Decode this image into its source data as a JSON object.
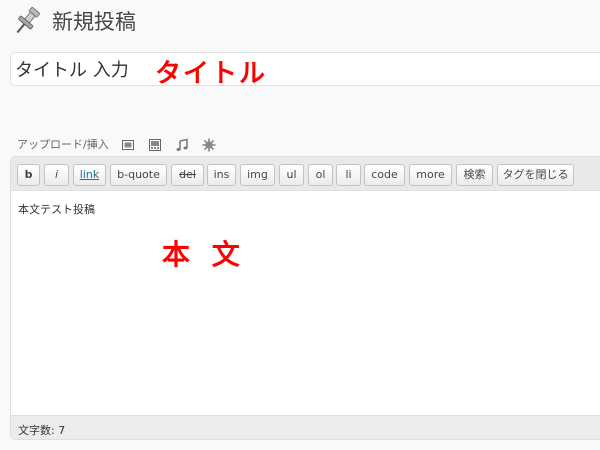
{
  "header": {
    "title": "新規投稿",
    "icon": "pushpin-icon"
  },
  "title_field": {
    "value": "タイトル 入力",
    "annotation": "タイトル"
  },
  "media": {
    "label": "アップロード/挿入",
    "icons": [
      "image-icon",
      "gallery-icon",
      "audio-icon",
      "media-icon"
    ]
  },
  "toolbar": {
    "buttons": [
      {
        "label": "b"
      },
      {
        "label": "i"
      },
      {
        "label": "link"
      },
      {
        "label": "b-quote"
      },
      {
        "label": "del"
      },
      {
        "label": "ins"
      },
      {
        "label": "img"
      },
      {
        "label": "ul"
      },
      {
        "label": "ol"
      },
      {
        "label": "li"
      },
      {
        "label": "code"
      },
      {
        "label": "more"
      },
      {
        "label": "検索"
      },
      {
        "label": "タグを閉じる"
      }
    ]
  },
  "editor": {
    "body_text": "本文テスト投稿",
    "annotation": "本 文"
  },
  "status": {
    "word_count": "文字数: 7"
  },
  "colors": {
    "annotation": "#ff0000",
    "link": "#21759b",
    "toolbar_bg": "#e9e9e9"
  }
}
